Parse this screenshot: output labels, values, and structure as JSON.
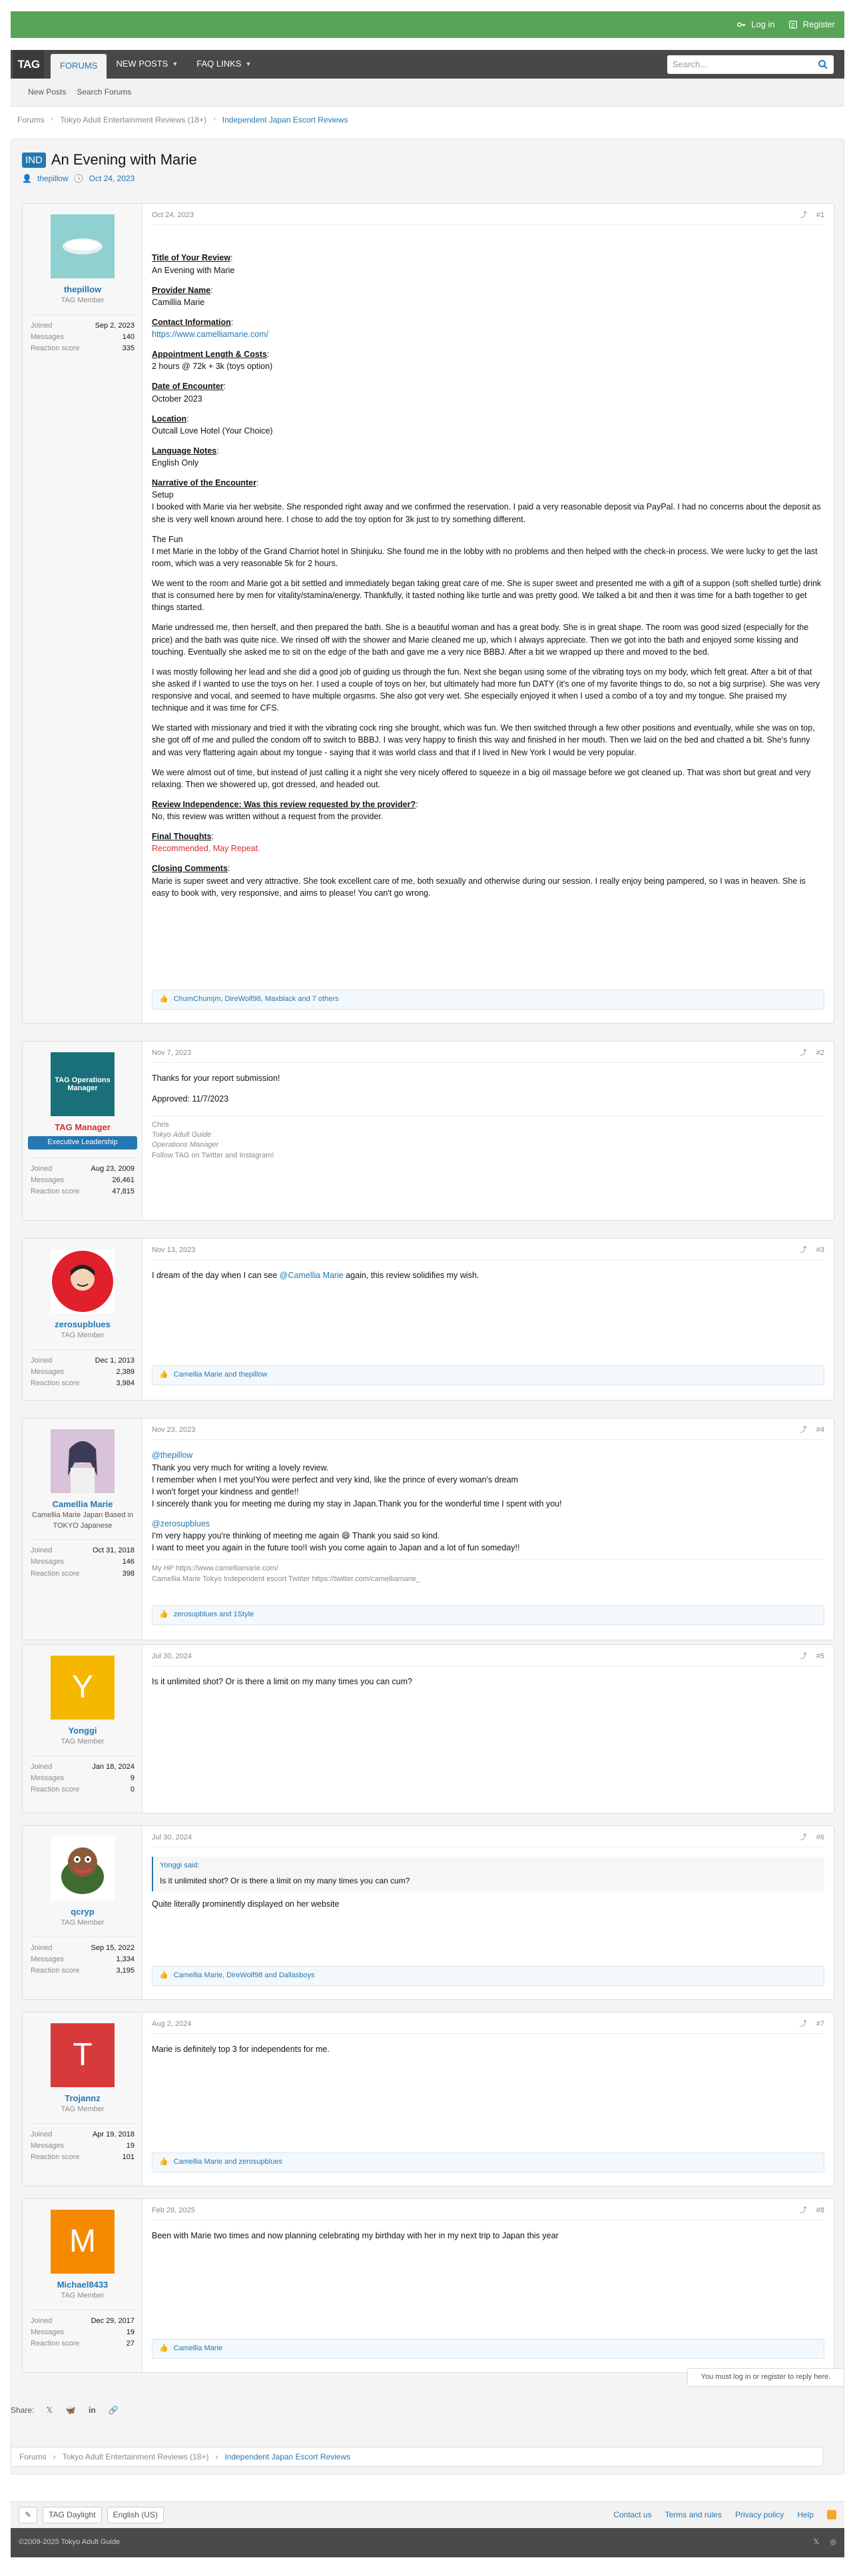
{
  "topbar": {
    "login": "Log in",
    "register": "Register"
  },
  "nav": {
    "logo": "TAG",
    "tabs": [
      {
        "label": "FORUMS",
        "active": true
      },
      {
        "label": "NEW POSTS",
        "active": false
      },
      {
        "label": "FAQ LINKS",
        "active": false
      }
    ],
    "search_placeholder": "Search..."
  },
  "subnav": {
    "items": [
      "New Posts",
      "Search Forums"
    ]
  },
  "breadcrumbs": [
    "Forums",
    "Tokyo Adult Entertainment Reviews (18+)",
    "Independent Japan Escort Reviews"
  ],
  "thread": {
    "prefix": "IND",
    "title": "An Evening with Marie",
    "author": "thepillow",
    "date": "Oct 24, 2023"
  },
  "posts": [
    {
      "user": "thepillow",
      "title": "TAG Member",
      "stats": [
        [
          "Joined",
          "Sep 2, 2023"
        ],
        [
          "Messages",
          "140"
        ],
        [
          "Reaction score",
          "335"
        ]
      ],
      "date": "Oct 24, 2023",
      "num": "#1",
      "review": {
        "title_label": "Title of Your Review",
        "title_val": "An Evening with Marie",
        "provider_label": "Provider Name",
        "provider_val": "Camillia Marie",
        "contact_label": "Contact Information",
        "contact_val": "https://www.camelliamarie.com/",
        "appt_label": "Appointment Length & Costs",
        "appt_val": "2 hours @ 72k + 3k (toys option)",
        "date_label": "Date of Encounter",
        "date_val": "October 2023",
        "loc_label": "Location",
        "loc_val": "Outcall Love Hotel (Your Choice)",
        "lang_label": "Language Notes",
        "lang_val": "English Only",
        "narr_label": "Narrative of the Encounter",
        "setup_h": "Setup",
        "setup": "I booked with Marie via her website. She responded right away and we confirmed the reservation. I paid a very reasonable deposit via PayPal. I had no concerns about the deposit as she is very well known around here. I chose to add the toy option for 3k just to try something different.",
        "fun_h": "The Fun",
        "fun1": "I met Marie in the lobby of the Grand Charriot hotel in Shinjuku. She found me in the lobby with no problems and then helped with the check-in process. We were lucky to get the last room, which was a very reasonable 5k for 2 hours.",
        "fun2": "We went to the room and Marie got a bit settled and immediately began taking great care of me. She is super sweet and presented me with a gift of a suppon (soft shelled turtle) drink that is consumed here by men for vitality/stamina/energy. Thankfully, it tasted nothing like turtle and was pretty good. We talked a bit and then it was time for a bath together to get things started.",
        "fun3": "Marie undressed me, then herself, and then prepared the bath. She is a beautiful woman and has a great body. She is in great shape. The room was good sized (especially for the price) and the bath was quite nice. We rinsed off with the shower and Marie cleaned me up, which I always appreciate. Then we got into the bath and enjoyed some kissing and touching. Eventually she asked me to sit on the edge of the bath and gave me a very nice BBBJ. After a bit we wrapped up there and moved to the bed.",
        "fun4": "I was mostly following her lead and she did a good job of guiding us through the fun. Next she began using some of the vibrating toys on my body, which felt great. After a bit of that she asked if I wanted to use the toys on her. I used a couple of toys on her, but ultimately had more fun DATY (it's one of my favorite things to do, so not a big surprise). She was very responsive and vocal, and seemed to have multiple orgasms. She also got very wet. She especially enjoyed it when I used a combo of a toy and my tongue. She praised my technique and it was time for CFS.",
        "fun5": "We started with missionary and tried it with the vibrating cock ring she brought, which was fun. We then switched through a few other positions and eventually, while she was on top, she got off of me and pulled the condom off to switch to BBBJ. I was very happy to finish this way and finished in her mouth. Then we laid on the bed and chatted a bit. She's funny and was very flattering again about my tongue - saying that it was world class and that if I lived in New York I would be very popular.",
        "fun6": "We were almost out of time, but instead of just calling it a night she very nicely offered to squeeze in a big oil massage before we got cleaned up. That was short but great and very relaxing. Then we showered up, got dressed, and headed out.",
        "indep_label": "Review Independence: Was this review requested by the provider?",
        "indep_val": "No, this review was written without a request from the provider.",
        "final_label": "Final Thoughts",
        "final_val": "Recommended, May Repeat.",
        "closing_label": "Closing Comments",
        "closing_val": "Marie is super sweet and very attractive. She took excellent care of me, both sexually and otherwise during our session. I really enjoy being pampered, so I was in heaven. She is easy to book with, very responsive, and aims to please! You can't go wrong."
      },
      "reactions": "ChumChum|m, DireWolf98, Maxblack and 7 others"
    },
    {
      "user": "TAG Manager",
      "title": "Executive Leadership",
      "avatar_text": "TAG Operations Manager",
      "stats": [
        [
          "Joined",
          "Aug 23, 2009"
        ],
        [
          "Messages",
          "26,461"
        ],
        [
          "Reaction score",
          "47,815"
        ]
      ],
      "date": "Nov 7, 2023",
      "num": "#2",
      "lines": [
        "Thanks for your report submission!",
        "Approved: 11/7/2023"
      ],
      "sig": [
        "Chris",
        "Tokyo Adult Guide",
        "Operations Manager",
        "Follow TAG on Twitter and Instagram!"
      ]
    },
    {
      "user": "zerosupblues",
      "title": "TAG Member",
      "stats": [
        [
          "Joined",
          "Dec 1, 2013"
        ],
        [
          "Messages",
          "2,389"
        ],
        [
          "Reaction score",
          "3,984"
        ]
      ],
      "date": "Nov 13, 2023",
      "num": "#3",
      "text_a": "I dream of the day when I can see ",
      "mention": "@Camellia Marie",
      "text_b": " again, this review solidifies my wish.",
      "reactions": "Camellia Marie and thepillow"
    },
    {
      "user": "Camellia Marie",
      "title": "Camellia Marie Japan Based in TOKYO Japanese",
      "stats": [
        [
          "Joined",
          "Oct 31, 2018"
        ],
        [
          "Messages",
          "146"
        ],
        [
          "Reaction score",
          "398"
        ]
      ],
      "date": "Nov 23, 2023",
      "num": "#4",
      "mention1": "@thepillow",
      "lines1": [
        "Thank you very much for writing a lovely review.",
        "I remember when I met you!You were perfect and very kind, like the prince of every woman's dream",
        "I won't forget your kindness and gentle!!",
        "I sincerely thank you for meeting me during my stay in Japan.Thank you for the wonderful time I spent with you!"
      ],
      "mention2": "@zerosupblues",
      "lines2": [
        "I'm very happy you're thinking of meeting me again 😄 Thank you said so kind.",
        "I want to meet you again in the future too!I wish you come again to Japan and a lot of fun someday!!"
      ],
      "sig": [
        "My HP https://www.camelliamarie.com/",
        "Camellia Marie Tokyo Independent escort Twitter https://twitter.com/camelliamarie_"
      ],
      "reactions": "zerosupblues and 1Style"
    },
    {
      "user": "Yonggi",
      "title": "TAG Member",
      "initial": "Y",
      "stats": [
        [
          "Joined",
          "Jan 18, 2024"
        ],
        [
          "Messages",
          "9"
        ],
        [
          "Reaction score",
          "0"
        ]
      ],
      "date": "Jul 30, 2024",
      "num": "#5",
      "lines": [
        "Is it unlimited shot? Or is there a limit on my many times you can cum?"
      ]
    },
    {
      "user": "qcryp",
      "title": "TAG Member",
      "stats": [
        [
          "Joined",
          "Sep 15, 2022"
        ],
        [
          "Messages",
          "1,334"
        ],
        [
          "Reaction score",
          "3,195"
        ]
      ],
      "date": "Jul 30, 2024",
      "num": "#6",
      "quote_head": "Yonggi said:",
      "quote_text": "Is it unlimited shot? Or is there a limit on my many times you can cum?",
      "lines": [
        "Quite literally prominently displayed on her website"
      ],
      "reactions": "Camellia Marie, DireWolf98 and Dallasboys"
    },
    {
      "user": "Trojannz",
      "title": "TAG Member",
      "initial": "T",
      "stats": [
        [
          "Joined",
          "Apr 19, 2018"
        ],
        [
          "Messages",
          "19"
        ],
        [
          "Reaction score",
          "101"
        ]
      ],
      "date": "Aug 2, 2024",
      "num": "#7",
      "lines": [
        "Marie is definitely top 3 for independents for me."
      ],
      "reactions": "Camellia Marie and zerosupblues"
    },
    {
      "user": "Michael8433",
      "title": "TAG Member",
      "initial": "M",
      "stats": [
        [
          "Joined",
          "Dec 29, 2017"
        ],
        [
          "Messages",
          "19"
        ],
        [
          "Reaction score",
          "27"
        ]
      ],
      "date": "Feb 28, 2025",
      "num": "#8",
      "lines": [
        "Been with Marie two times and now planning celebrating my birthday with her in my next trip to Japan this year"
      ],
      "reactions": "Camellia Marie"
    }
  ],
  "reply_note": "You must log in or register to reply here.",
  "share_label": "Share:",
  "footer": {
    "style": "TAG Daylight",
    "lang": "English (US)",
    "links": [
      "Contact us",
      "Terms and rules",
      "Privacy policy",
      "Help"
    ],
    "copyright": "©2009-2025 Tokyo Adult Guide"
  },
  "colors": {
    "accent": "#2577b1",
    "topbar": "#57a557",
    "navbar": "#484848",
    "red": "#d62f2f"
  }
}
